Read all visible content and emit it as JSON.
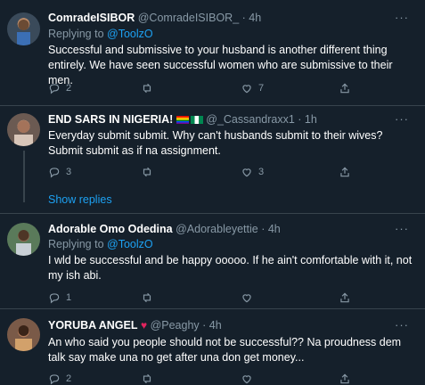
{
  "tweets": [
    {
      "name": "ComradeISIBOR",
      "handle": "@ComradeISIBOR_",
      "time": "· 4h",
      "replying_prefix": "Replying to ",
      "replying_to": "@ToolzO",
      "text": "Successful and submissive to your husband is another different thing entirely. We have seen successful women who are submissive to their men.",
      "replies": "2",
      "retweets": "",
      "likes": "7"
    },
    {
      "name": "END SARS IN NIGERIA!",
      "handle": "@_Cassandraxx1",
      "time": "· 1h",
      "text": "Everyday submit submit. Why can't husbands submit to their wives? Submit submit as if na assignment.",
      "replies": "3",
      "retweets": "",
      "likes": "3",
      "show_replies": "Show replies"
    },
    {
      "name": "Adorable Omo Odedina",
      "handle": "@Adorableyettie",
      "time": "· 4h",
      "replying_prefix": "Replying to ",
      "replying_to": "@ToolzO",
      "text": "I wld be successful and be happy ooooo. If he ain't comfortable with it, not my ish abi.",
      "replies": "1",
      "retweets": "",
      "likes": ""
    },
    {
      "name": "YORUBA ANGEL",
      "handle": "@Peaghy",
      "time": "· 4h",
      "text": "An who said you people should not be successful?? Na proudness dem talk say make una no get after una don get money...",
      "replies": "2",
      "retweets": "",
      "likes": ""
    }
  ],
  "more_label": "···",
  "colors": {
    "background": "#15202b",
    "link": "#1da1f2",
    "muted": "#8899a6",
    "divider": "#38444d"
  }
}
